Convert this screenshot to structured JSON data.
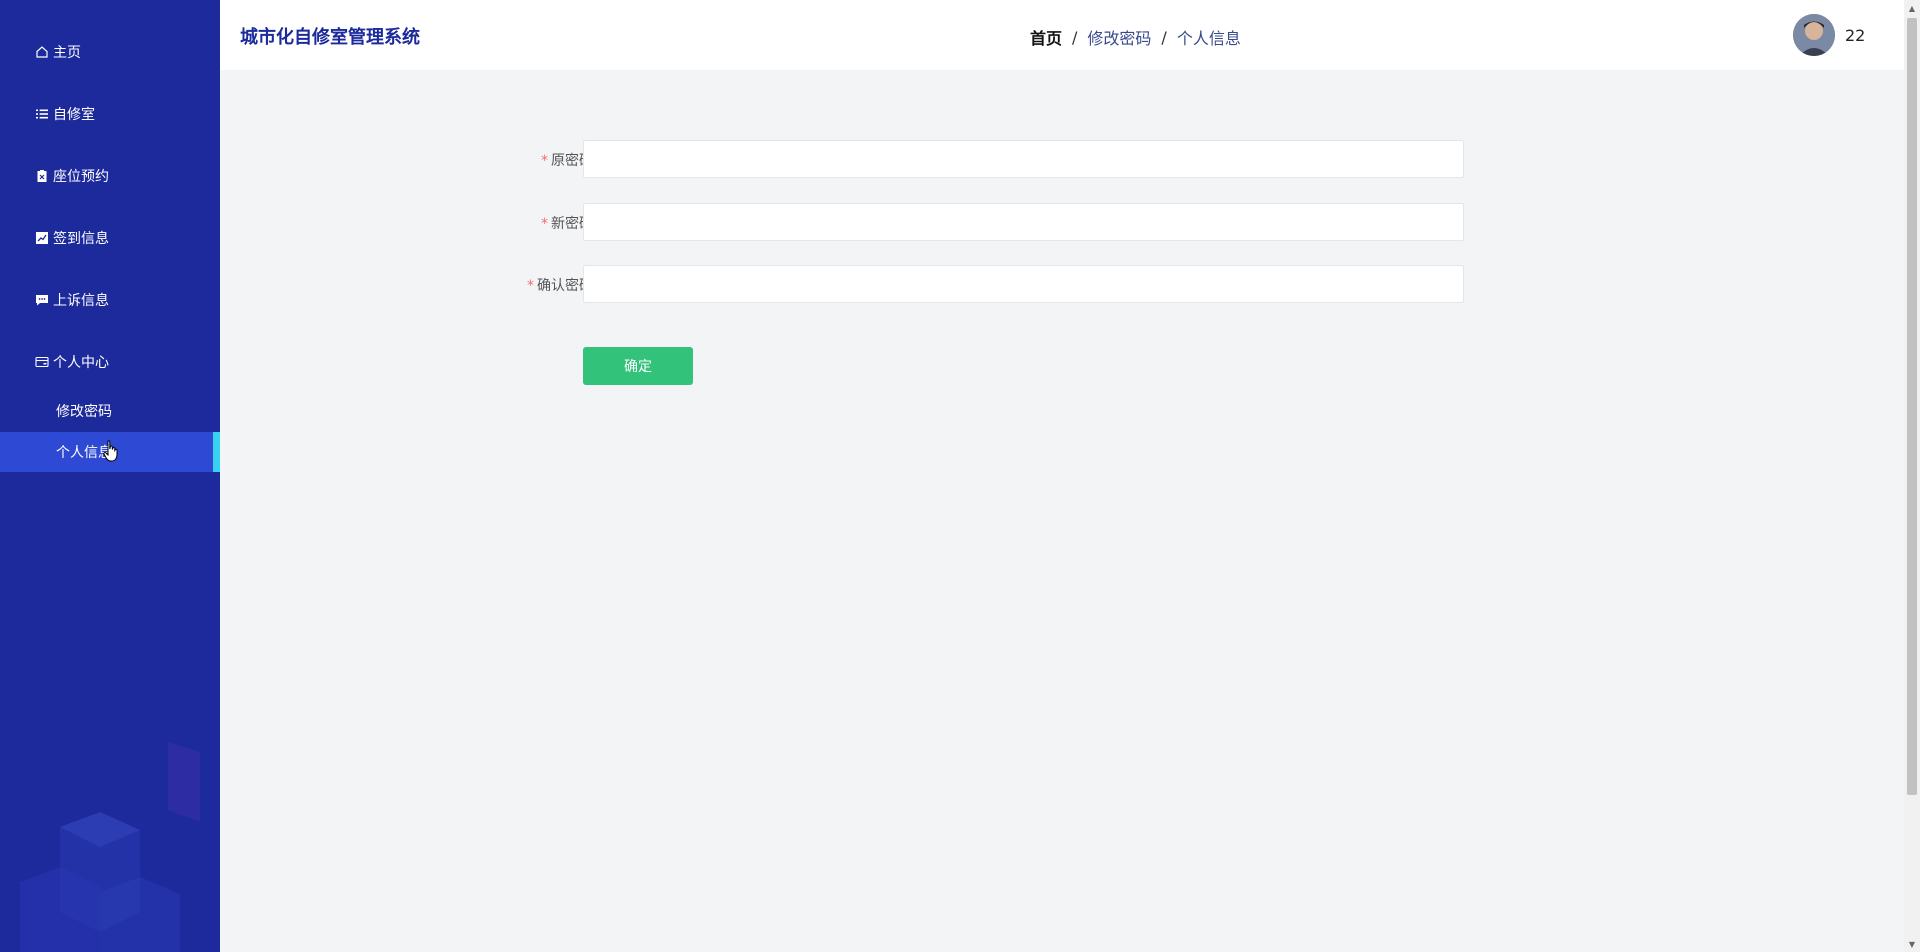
{
  "app": {
    "title": "城市化自修室管理系统"
  },
  "sidebar": {
    "items": [
      {
        "label": "主页",
        "icon": "home-icon"
      },
      {
        "label": "自修室",
        "icon": "list-icon"
      },
      {
        "label": "座位预约",
        "icon": "clipboard-icon"
      },
      {
        "label": "签到信息",
        "icon": "chart-icon"
      },
      {
        "label": "上诉信息",
        "icon": "chat-icon"
      },
      {
        "label": "个人中心",
        "icon": "card-icon"
      }
    ],
    "sub_items": [
      {
        "label": "修改密码"
      },
      {
        "label": "个人信息",
        "active": true
      }
    ],
    "active_color": "#2e49d4",
    "active_marker_color": "#37d2f0",
    "background_color": "#1c2a9c"
  },
  "header": {
    "breadcrumb": [
      "首页",
      "修改密码",
      "个人信息"
    ],
    "breadcrumb_separator": "/",
    "username": "22"
  },
  "form": {
    "fields": [
      {
        "label": "原密码",
        "required": true,
        "value": ""
      },
      {
        "label": "新密码",
        "required": true,
        "value": ""
      },
      {
        "label": "确认密码",
        "required": true,
        "value": ""
      }
    ],
    "required_mark": "*",
    "submit_label": "确定",
    "submit_color": "#32c27a"
  }
}
